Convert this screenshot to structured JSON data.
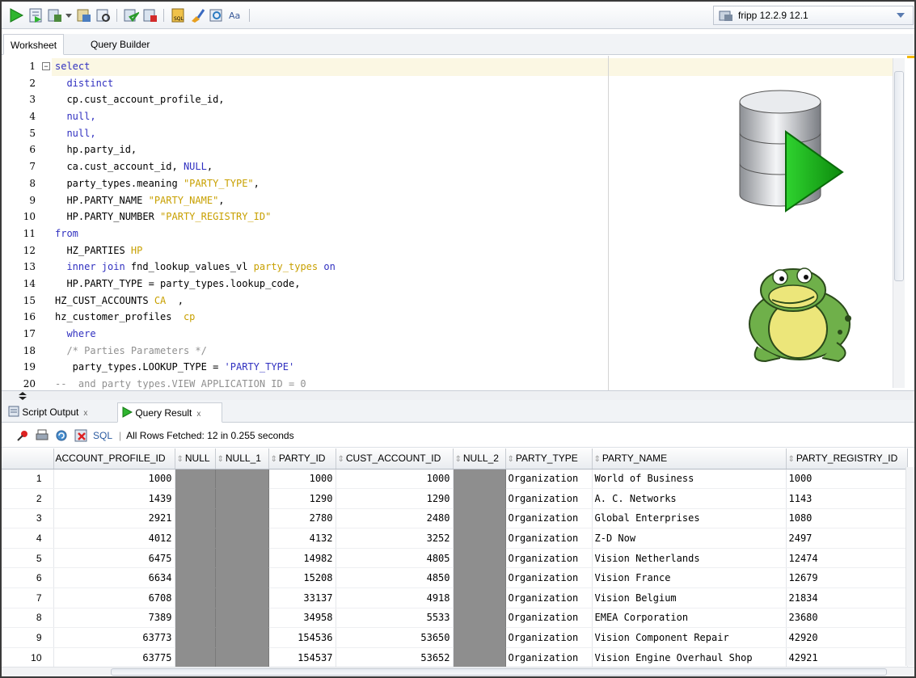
{
  "toolbar": {
    "buttons": [
      "run-statement-icon",
      "run-script-icon",
      "commit-icon",
      "rollback-icon",
      "autotrace-icon",
      "explain-plan-icon",
      "sql-tuning-icon",
      "clear-icon",
      "history-icon",
      "format-icon"
    ],
    "connection_label": "fripp 12.2.9 12.1"
  },
  "worksheet_tabs": [
    "Worksheet",
    "Query Builder"
  ],
  "editor": {
    "line_numbers": [
      "1",
      "2",
      "3",
      "4",
      "5",
      "6",
      "7",
      "8",
      "9",
      "10",
      "11",
      "12",
      "13",
      "14",
      "15",
      "16",
      "17",
      "18",
      "19",
      "20"
    ]
  },
  "result_tabs": {
    "script_output": "Script Output",
    "query_result": "Query Result",
    "close": "x"
  },
  "result_toolbar": {
    "sql_label": "SQL",
    "status": "All Rows Fetched: 12 in 0.255 seconds"
  },
  "grid": {
    "columns": [
      "ACCOUNT_PROFILE_ID",
      "NULL",
      "NULL_1",
      "PARTY_ID",
      "CUST_ACCOUNT_ID",
      "NULL_2",
      "PARTY_TYPE",
      "PARTY_NAME",
      "PARTY_REGISTRY_ID"
    ],
    "rows": [
      {
        "n": "1",
        "account_profile_id": "1000",
        "party_id": "1000",
        "cust_account_id": "1000",
        "party_type": "Organization",
        "party_name": "World of Business",
        "party_registry_id": "1000"
      },
      {
        "n": "2",
        "account_profile_id": "1439",
        "party_id": "1290",
        "cust_account_id": "1290",
        "party_type": "Organization",
        "party_name": "A. C. Networks",
        "party_registry_id": "1143"
      },
      {
        "n": "3",
        "account_profile_id": "2921",
        "party_id": "2780",
        "cust_account_id": "2480",
        "party_type": "Organization",
        "party_name": "Global Enterprises",
        "party_registry_id": "1080"
      },
      {
        "n": "4",
        "account_profile_id": "4012",
        "party_id": "4132",
        "cust_account_id": "3252",
        "party_type": "Organization",
        "party_name": "Z-D Now",
        "party_registry_id": "2497"
      },
      {
        "n": "5",
        "account_profile_id": "6475",
        "party_id": "14982",
        "cust_account_id": "4805",
        "party_type": "Organization",
        "party_name": "Vision Netherlands",
        "party_registry_id": "12474"
      },
      {
        "n": "6",
        "account_profile_id": "6634",
        "party_id": "15208",
        "cust_account_id": "4850",
        "party_type": "Organization",
        "party_name": "Vision France",
        "party_registry_id": "12679"
      },
      {
        "n": "7",
        "account_profile_id": "6708",
        "party_id": "33137",
        "cust_account_id": "4918",
        "party_type": "Organization",
        "party_name": "Vision Belgium",
        "party_registry_id": "21834"
      },
      {
        "n": "8",
        "account_profile_id": "7389",
        "party_id": "34958",
        "cust_account_id": "5533",
        "party_type": "Organization",
        "party_name": "EMEA Corporation",
        "party_registry_id": "23680"
      },
      {
        "n": "9",
        "account_profile_id": "63773",
        "party_id": "154536",
        "cust_account_id": "53650",
        "party_type": "Organization",
        "party_name": "Vision Component Repair",
        "party_registry_id": "42920"
      },
      {
        "n": "10",
        "account_profile_id": "63775",
        "party_id": "154537",
        "cust_account_id": "53652",
        "party_type": "Organization",
        "party_name": "Vision Engine Overhaul Shop",
        "party_registry_id": "42921"
      }
    ]
  },
  "code_lines": [
    [
      {
        "t": "select",
        "c": "kw"
      }
    ],
    [
      {
        "t": "  distinct",
        "c": "kw"
      }
    ],
    [
      {
        "t": "  cp.cust_account_profile_id,",
        "c": ""
      }
    ],
    [
      {
        "t": "  null,",
        "c": "kw"
      }
    ],
    [
      {
        "t": "  null,",
        "c": "kw"
      }
    ],
    [
      {
        "t": "  hp.party_id,",
        "c": ""
      }
    ],
    [
      {
        "t": "  ca.cust_account_id, ",
        "c": ""
      },
      {
        "t": "NULL",
        "c": "kw"
      },
      {
        "t": ",",
        "c": ""
      }
    ],
    [
      {
        "t": "  party_types.meaning ",
        "c": ""
      },
      {
        "t": "\"PARTY_TYPE\"",
        "c": "str"
      },
      {
        "t": ",",
        "c": ""
      }
    ],
    [
      {
        "t": "  HP.PARTY_NAME ",
        "c": ""
      },
      {
        "t": "\"PARTY_NAME\"",
        "c": "str"
      },
      {
        "t": ",",
        "c": ""
      }
    ],
    [
      {
        "t": "  HP.PARTY_NUMBER ",
        "c": ""
      },
      {
        "t": "\"PARTY_REGISTRY_ID\"",
        "c": "str"
      }
    ],
    [
      {
        "t": "from",
        "c": "kw"
      }
    ],
    [
      {
        "t": "  HZ_PARTIES ",
        "c": ""
      },
      {
        "t": "HP",
        "c": "str"
      }
    ],
    [
      {
        "t": "  inner join",
        "c": "kw"
      },
      {
        "t": " fnd_lookup_values_vl ",
        "c": ""
      },
      {
        "t": "party_types",
        "c": "str"
      },
      {
        "t": " on",
        "c": "kw"
      }
    ],
    [
      {
        "t": "  HP.PARTY_TYPE = party_types.lookup_code,",
        "c": ""
      }
    ],
    [
      {
        "t": "HZ_CUST_ACCOUNTS ",
        "c": ""
      },
      {
        "t": "CA",
        "c": "str"
      },
      {
        "t": "  ,",
        "c": ""
      }
    ],
    [
      {
        "t": "hz_customer_profiles  ",
        "c": ""
      },
      {
        "t": "cp",
        "c": "str"
      }
    ],
    [
      {
        "t": "  where",
        "c": "kw"
      }
    ],
    [
      {
        "t": "  /* Parties Parameters */",
        "c": "cmt"
      }
    ],
    [
      {
        "t": "   party_types.LOOKUP_TYPE = ",
        "c": ""
      },
      {
        "t": "'PARTY_TYPE'",
        "c": "kw"
      }
    ],
    [
      {
        "t": "--  and party types.VIEW APPLICATION ID = 0",
        "c": "cmt"
      }
    ]
  ]
}
